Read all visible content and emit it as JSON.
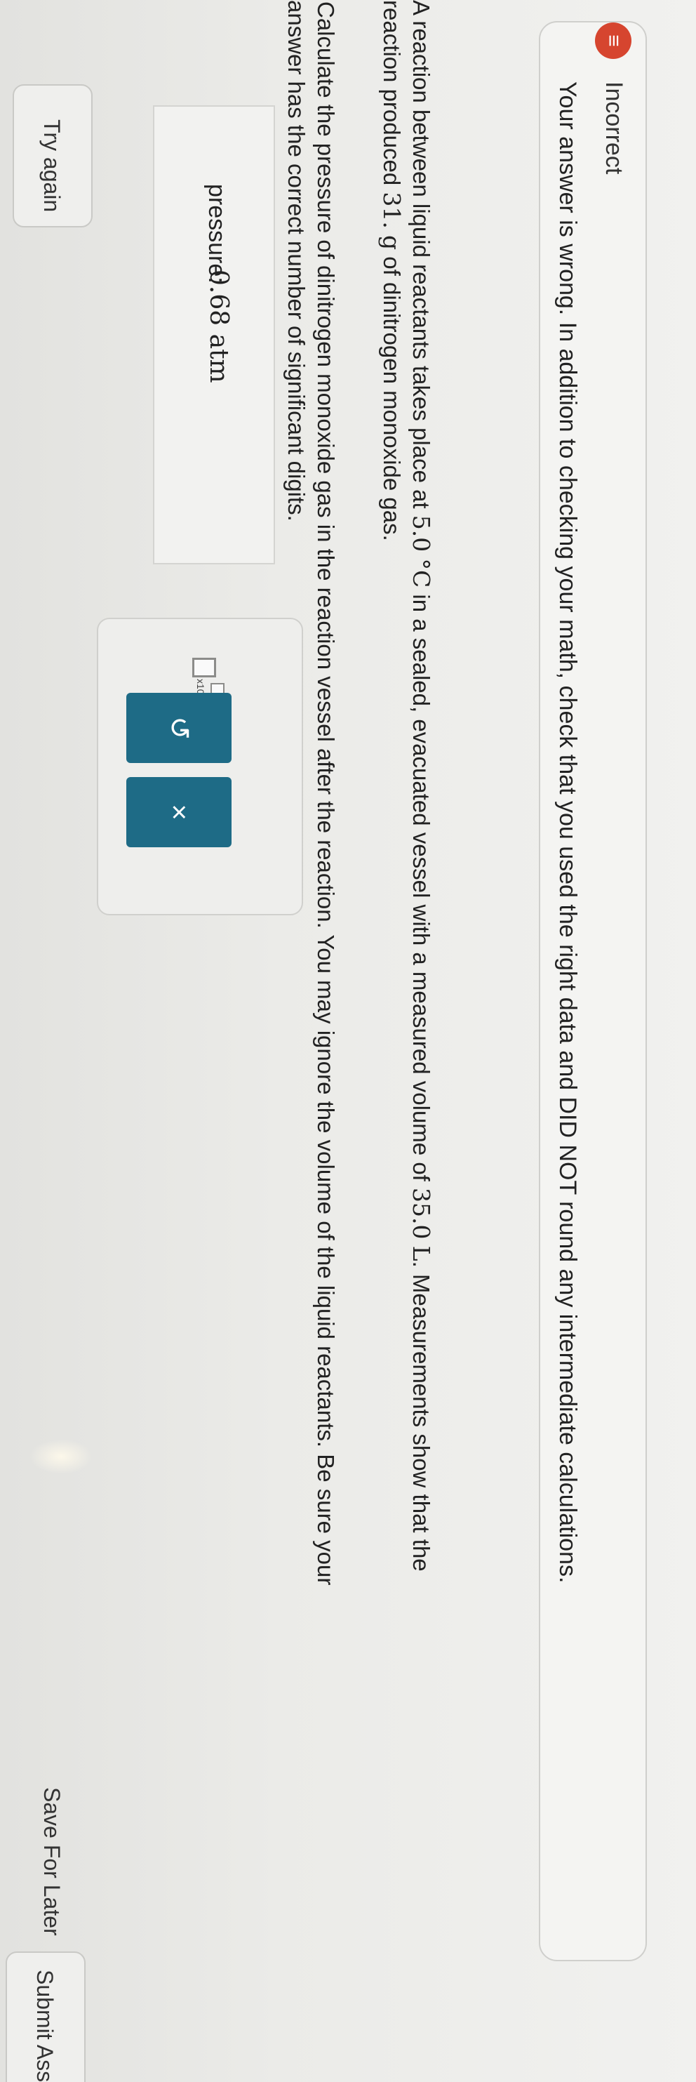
{
  "feedback": {
    "icon": "list-icon",
    "title": "Incorrect",
    "message": "Your answer is wrong. In addition to checking your math, check that you used the right data and DID NOT round any intermediate calculations."
  },
  "problem": {
    "line1a": "A reaction between liquid reactants takes place at ",
    "temp_value": "5.0",
    "temp_unit": "°C",
    "line1a_cont": " in a sealed, evacuated vessel with a measured volume of ",
    "volume_value": "35.0",
    "volume_unit": "L",
    "line1a_end": ". Measurements show that the",
    "line1b_start": "reaction produced ",
    "mass_value": "31.",
    "mass_unit": "g",
    "line1b_end": " of dinitrogen monoxide gas.",
    "line2a": "Calculate the pressure of dinitrogen monoxide gas in the reaction vessel after the reaction. You may ignore the volume of the liquid reactants. Be sure your",
    "line2b": "answer has the correct number of significant digits."
  },
  "answer": {
    "label": "pressure:",
    "value": "0.68 atm"
  },
  "tools": {
    "x10_label": "x10",
    "undo_symbol": "↺",
    "clear_symbol": "×"
  },
  "footer": {
    "try_again": "Try again",
    "save_later": "Save For Later",
    "submit": "Submit Assig"
  }
}
